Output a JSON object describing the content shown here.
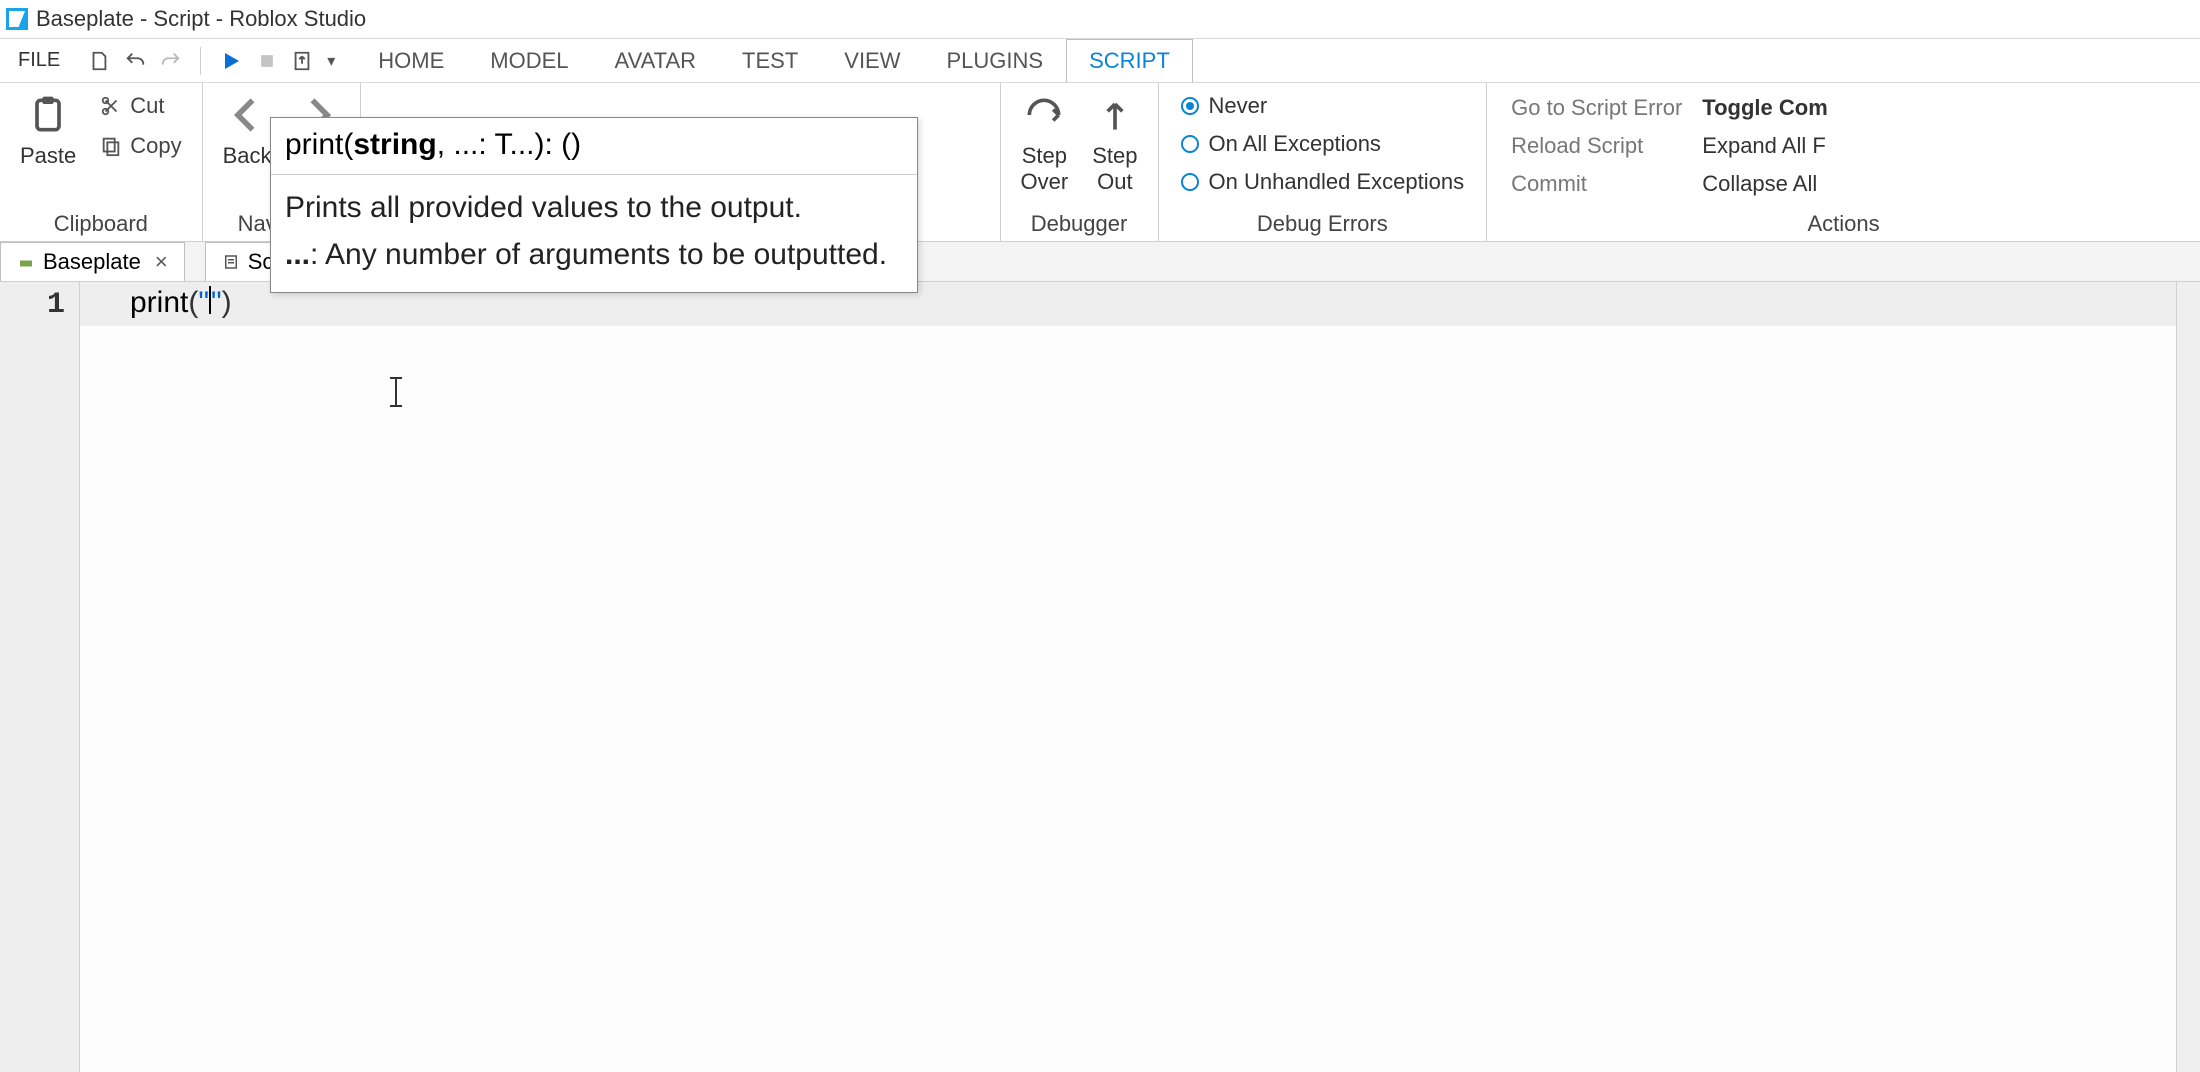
{
  "window": {
    "title": "Baseplate - Script - Roblox Studio"
  },
  "menubar": {
    "file": "FILE",
    "tabs": [
      "HOME",
      "MODEL",
      "AVATAR",
      "TEST",
      "VIEW",
      "PLUGINS",
      "SCRIPT"
    ],
    "active_tab_index": 6
  },
  "ribbon": {
    "clipboard": {
      "paste": "Paste",
      "cut": "Cut",
      "copy": "Copy",
      "label": "Clipboard"
    },
    "navigate": {
      "back": "Back",
      "fwd": "Fwd",
      "label": "Navigate"
    },
    "debugger": {
      "step_over": "Step\nOver",
      "step_out": "Step\nOut",
      "label": "Debugger"
    },
    "debug_errors": {
      "label": "Debug Errors",
      "options": [
        "Never",
        "On All Exceptions",
        "On Unhandled Exceptions"
      ],
      "selected_index": 0
    },
    "actions": {
      "label": "Actions",
      "items": [
        {
          "label": "Go to Script Error",
          "enabled": false
        },
        {
          "label": "Reload Script",
          "enabled": false
        },
        {
          "label": "Commit",
          "enabled": false
        },
        {
          "label": "Toggle Com",
          "enabled": true,
          "bold": true
        },
        {
          "label": "Expand All F",
          "enabled": true
        },
        {
          "label": "Collapse All",
          "enabled": true
        }
      ]
    }
  },
  "doc_tabs": {
    "baseplate": "Baseplate",
    "script": "Script"
  },
  "editor": {
    "line_number": "1",
    "code_tokens": {
      "fn": "print",
      "lp": "(",
      "q1": "\"",
      "q2": "\"",
      "rp": ")"
    }
  },
  "tooltip": {
    "sig_pre": "print(",
    "sig_bold": "string",
    "sig_post": ", ...: T...): ()",
    "line1": "Prints all provided values to the output.",
    "line2_prefix": "...",
    "line2_rest": ": Any number of arguments to be outputted."
  }
}
